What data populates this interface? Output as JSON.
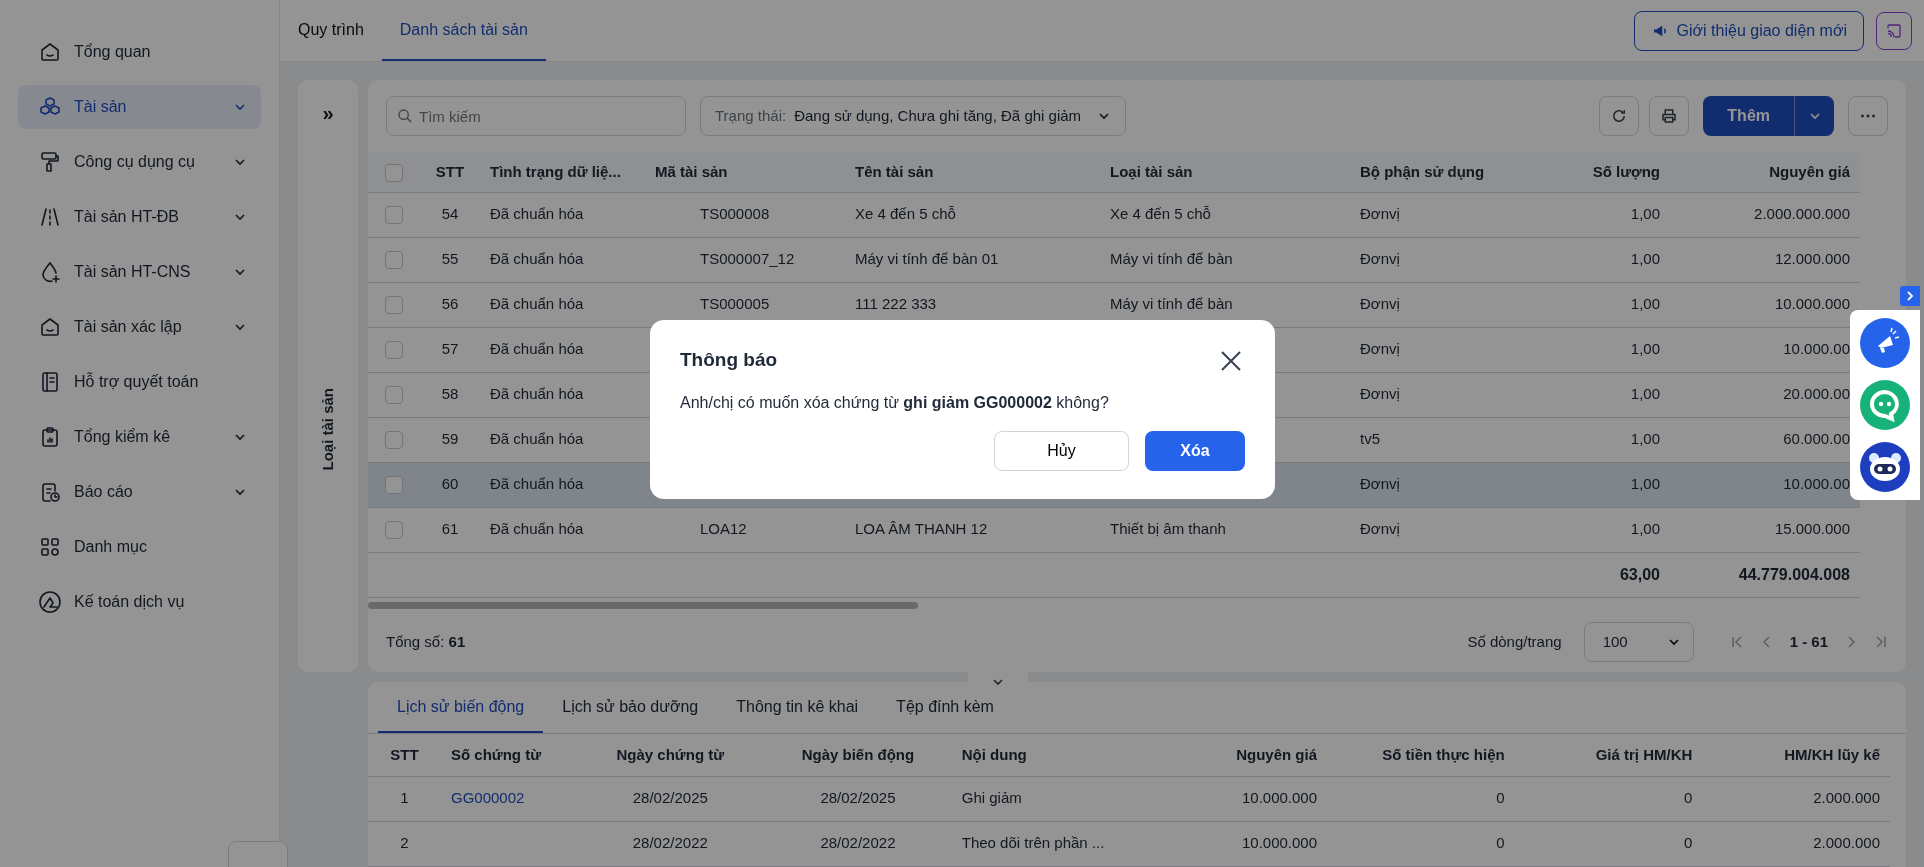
{
  "sidebar": {
    "items": [
      {
        "label": "Tổng quan",
        "selected": false,
        "expandable": false
      },
      {
        "label": "Tài sản",
        "selected": true,
        "expandable": true
      },
      {
        "label": "Công cụ dụng cụ",
        "selected": false,
        "expandable": true
      },
      {
        "label": "Tài sản HT-ĐB",
        "selected": false,
        "expandable": true
      },
      {
        "label": "Tài sản HT-CNS",
        "selected": false,
        "expandable": true
      },
      {
        "label": "Tài sản xác lập",
        "selected": false,
        "expandable": true
      },
      {
        "label": "Hỗ trợ quyết toán",
        "selected": false,
        "expandable": false
      },
      {
        "label": "Tổng kiểm kê",
        "selected": false,
        "expandable": true
      },
      {
        "label": "Báo cáo",
        "selected": false,
        "expandable": true
      },
      {
        "label": "Danh mục",
        "selected": false,
        "expandable": false
      },
      {
        "label": "Kế toán dịch vụ",
        "selected": false,
        "expandable": false
      }
    ]
  },
  "tabs": [
    {
      "label": "Quy trình",
      "selected": false
    },
    {
      "label": "Danh sách tài sản",
      "selected": true
    }
  ],
  "header_buttons": {
    "intro": "Giới thiệu giao diện mới"
  },
  "filter_panel": {
    "expand": "»",
    "title": "Loại tài sản"
  },
  "toolbar": {
    "search": {
      "placeholder": "Tìm kiếm"
    },
    "status": {
      "label": "Trạng thái:",
      "value": "Đang sử dụng, Chưa ghi tăng, Đã ghi giảm"
    },
    "add": "Thêm"
  },
  "table": {
    "header_checked": false,
    "columns": [
      "STT",
      "Tình trạng dữ liệ...",
      "Mã tài sản",
      "Tên tài sản",
      "Loại tài sản",
      "Bộ phận sử dụng",
      "Số lượng",
      "Nguyên giá"
    ],
    "rows": [
      {
        "checked": false,
        "selected": false,
        "cells": [
          "54",
          "Đã chuẩn hóa",
          "TS000008",
          "Xe 4 đến 5 chỗ",
          "Xe 4 đến 5 chỗ",
          "Đơnvị",
          "1,00",
          "2.000.000.000"
        ]
      },
      {
        "checked": false,
        "selected": false,
        "cells": [
          "55",
          "Đã chuẩn hóa",
          "TS000007_12",
          "Máy vi tính để bàn 01",
          "Máy vi tính để bàn",
          "Đơnvị",
          "1,00",
          "12.000.000"
        ]
      },
      {
        "checked": false,
        "selected": false,
        "cells": [
          "56",
          "Đã chuẩn hóa",
          "TS000005",
          "111 222 333",
          "Máy vi tính để bàn",
          "Đơnvị",
          "1,00",
          "10.000.000"
        ]
      },
      {
        "checked": false,
        "selected": false,
        "cells": [
          "57",
          "Đã chuẩn hóa",
          null,
          null,
          null,
          "Đơnvị",
          "1,00",
          "10.000.00"
        ]
      },
      {
        "checked": false,
        "selected": false,
        "cells": [
          "58",
          "Đã chuẩn hóa",
          null,
          null,
          null,
          "Đơnvị",
          "1,00",
          "20.000.00"
        ]
      },
      {
        "checked": false,
        "selected": false,
        "cells": [
          "59",
          "Đã chuẩn hóa",
          null,
          null,
          null,
          "tv5",
          "1,00",
          "60.000.00"
        ]
      },
      {
        "checked": false,
        "selected": true,
        "cells": [
          "60",
          "Đã chuẩn hóa",
          null,
          null,
          null,
          "Đơnvị",
          "1,00",
          "10.000.00"
        ]
      },
      {
        "checked": false,
        "selected": false,
        "cells": [
          "61",
          "Đã chuẩn hóa",
          "LOA12",
          "LOA ÂM THANH 12",
          "Thiết bị âm thanh",
          "Đơnvị",
          "1,00",
          "15.000.000"
        ]
      }
    ],
    "totals": {
      "quantity": "63,00",
      "cost": "44.779.004.008"
    }
  },
  "footer": {
    "total": "Tổng số: **61**",
    "page_size_label": "Số dòng/trang",
    "page_size": "100",
    "range": "1 - 61"
  },
  "detail_tabs": [
    {
      "label": "Lịch sử biến động",
      "selected": true
    },
    {
      "label": "Lịch sử bảo dưỡng",
      "selected": false
    },
    {
      "label": "Thông tin kê khai",
      "selected": false
    },
    {
      "label": "Tệp đính kèm",
      "selected": false
    }
  ],
  "detail_table": {
    "columns": [
      "STT",
      "Số chứng từ",
      "Ngày chứng từ",
      "Ngày biến động",
      "Nội dung",
      "Nguyên giá",
      "Số tiền thực hiện",
      "Giá trị HM/KH",
      "HM/KH lũy kế"
    ],
    "rows": [
      [
        "1",
        "GG000002",
        "28/02/2025",
        "28/02/2025",
        "Ghi giảm",
        "10.000.000",
        "0",
        "0",
        "2.000.000"
      ],
      [
        "2",
        null,
        "28/02/2022",
        "28/02/2022",
        "Theo dõi trên phần ...",
        "10.000.000",
        "0",
        "0",
        "2.000.000"
      ]
    ]
  },
  "dialog": {
    "title": "Thông báo",
    "message": "Anh/chị có muốn xóa chứng từ **ghi giảm GG000002** không?",
    "cancel": "Hủy",
    "confirm": "Xóa"
  }
}
